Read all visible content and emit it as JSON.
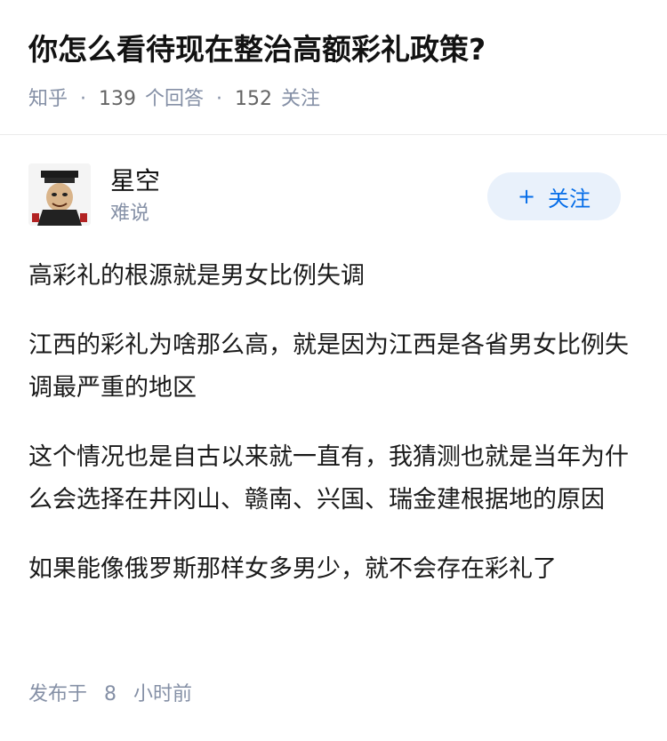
{
  "question": {
    "title": "你怎么看待现在整治高额彩礼政策?",
    "source": "知乎",
    "answer_count": "139",
    "answer_label": "个回答",
    "follower_count": "152",
    "follower_label": "关注",
    "separator": "·"
  },
  "answer": {
    "author": {
      "name": "星空",
      "bio": "难说",
      "avatar_icon": "meme-avatar-icon"
    },
    "follow_button": {
      "plus": "+",
      "label": "关注"
    },
    "paragraphs": [
      "高彩礼的根源就是男女比例失调",
      "江西的彩礼为啥那么高，就是因为江西是各省男女比例失调最严重的地区",
      "这个情况也是自古以来就一直有，我猜测也就是当年为什么会选择在井冈山、赣南、兴国、瑞金建根据地的原因",
      "如果能像俄罗斯那样女多男少，就不会存在彩礼了"
    ],
    "posted_prefix": "发布于",
    "posted_value": "8",
    "posted_unit": "小时前"
  },
  "colors": {
    "accent": "#056de8",
    "accent_bg": "#e9f1fb",
    "meta": "#8590a6",
    "text": "#1a1a1a"
  }
}
